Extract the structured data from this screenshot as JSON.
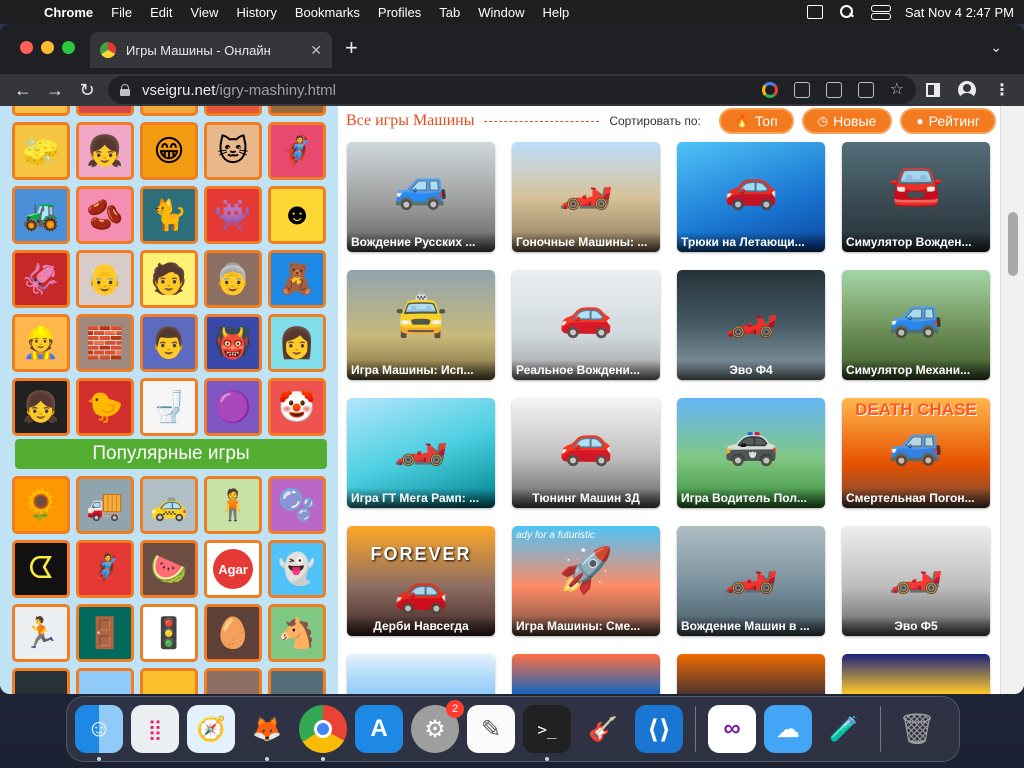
{
  "menubar": {
    "app": "Chrome",
    "items": [
      "File",
      "Edit",
      "View",
      "History",
      "Bookmarks",
      "Profiles",
      "Tab",
      "Window",
      "Help"
    ],
    "datetime": "Sat Nov 4  2:47 PM"
  },
  "browser": {
    "tab_title": "Игры Машины - Онлайн",
    "url_host": "vseigru.net",
    "url_path": "/igry-mashiny.html"
  },
  "sidebar": {
    "popular_label": "Популярные игры"
  },
  "main": {
    "section_title": "Все игры Машины",
    "sort_label": "Сортировать по:",
    "sort_buttons": [
      "Топ",
      "Новые",
      "Рейтинг"
    ]
  },
  "games": [
    "Вождение Русских ...",
    "Гоночные Машины: ...",
    "Трюки на Летающи...",
    "Симулятор Вожден...",
    "Игра Машины: Исп...",
    "Реальное Вождени...",
    "Эво Ф4",
    "Симулятор Механи...",
    "Игра ГТ Мега Рамп: ...",
    "Тюнинг Машин 3Д",
    "Игра Водитель Пол...",
    "Смертельная Погон...",
    "Дерби Навсегда",
    "Игра Машины: Сме...",
    "Вождение Машин в ...",
    "Эво Ф5"
  ],
  "card_art_text": {
    "death_chase": "DEATH CHASE",
    "forever": "FOREVER",
    "ready": "ady for a futuristic"
  },
  "dock": {
    "settings_badge": "2"
  }
}
